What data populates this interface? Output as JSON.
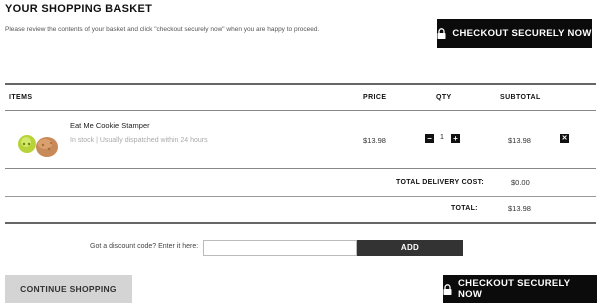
{
  "header": {
    "title": "YOUR SHOPPING BASKET",
    "intro": "Please review the contents of your basket and click \"checkout securely now\" when you are happy to proceed.",
    "checkout_label": "CHECKOUT SECURELY NOW"
  },
  "table": {
    "columns": [
      "ITEMS",
      "PRICE",
      "QTY",
      "SUBTOTAL"
    ],
    "rows": [
      {
        "name": "Eat Me Cookie Stamper",
        "stock": "In stock | Usually dispatched within 24 hours",
        "price": "$13.98",
        "qty": "1",
        "subtotal": "$13.98"
      }
    ]
  },
  "summary": {
    "delivery_label": "TOTAL DELIVERY COST:",
    "delivery_value": "$0.00",
    "total_label": "TOTAL:",
    "total_value": "$13.98"
  },
  "discount": {
    "label": "Got a discount code? Enter it here:",
    "value": "",
    "button_label": "ADD"
  },
  "footer": {
    "continue_label": "CONTINUE SHOPPING",
    "checkout_label": "CHECKOUT SECURELY NOW"
  },
  "icons": {
    "lock": "lock-icon",
    "minus": "minus-icon",
    "plus": "plus-icon",
    "remove": "close-icon"
  },
  "colors": {
    "primary_button": "#0b0b0b",
    "secondary_button": "#d4d4d4",
    "add_button": "#333333"
  }
}
